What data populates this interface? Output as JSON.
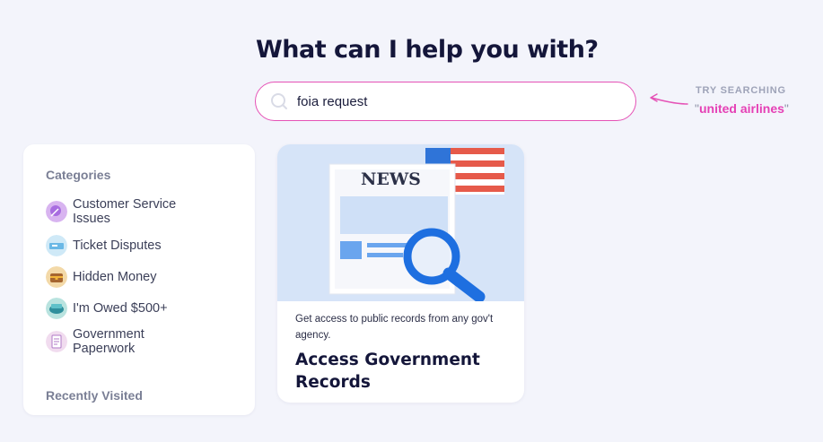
{
  "heading": "What can I help you with?",
  "search": {
    "value": "foia request"
  },
  "suggestion": {
    "label": "TRY SEARCHING",
    "open_quote": "\"",
    "term": "united airlines",
    "close_quote": "\""
  },
  "sidebar": {
    "categories_heading": "Categories",
    "items": [
      {
        "label": "Customer Service Issues",
        "icon": "customer-service-icon"
      },
      {
        "label": "Ticket Disputes",
        "icon": "ticket-icon"
      },
      {
        "label": "Hidden Money",
        "icon": "treasure-chest-icon"
      },
      {
        "label": "I'm Owed $500+",
        "icon": "money-owed-icon"
      },
      {
        "label": "Government Paperwork",
        "icon": "document-icon"
      }
    ],
    "recent_heading": "Recently Visited"
  },
  "card": {
    "image": "newspaper-flag-magnifier-illustration",
    "description": "Get access to public records from any gov't agency.",
    "title": "Access Government Records",
    "art_text": "NEWS"
  },
  "colors": {
    "accent": "#e540b5",
    "background": "#f3f4fb",
    "heading": "#14163a"
  }
}
